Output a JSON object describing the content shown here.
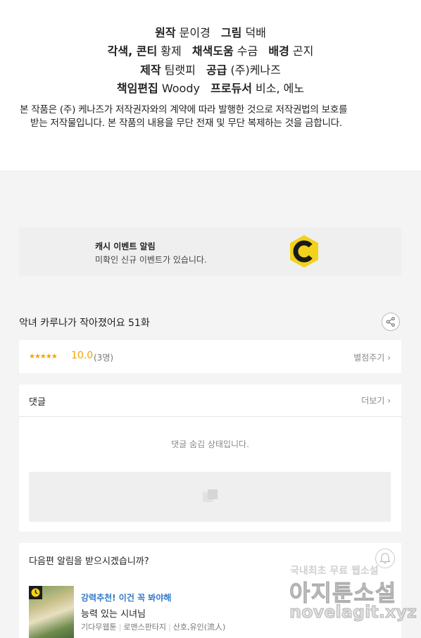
{
  "credits": {
    "line1": {
      "k1": "원작",
      "v1": "문이경",
      "k2": "그림",
      "v2": "덕배"
    },
    "line2": {
      "k1": "각색, 콘티",
      "v1": "황제",
      "k2": "채색도움",
      "v2": "수금",
      "k3": "배경",
      "v3": "곤지"
    },
    "line3": {
      "k1": "제작",
      "v1": "팀랫피",
      "k2": "공급",
      "v2": "(주)케나즈"
    },
    "line4": {
      "k1": "책임편집",
      "v1": "Woody",
      "k2": "프로듀서",
      "v2": "비소, 에노"
    },
    "notice_line1": "본 작품은 (주) 케나즈가 저작권자와의 계약에 따라 발행한 것으로 저작권법의 보호를",
    "notice_line2": "받는 저작물입니다. 본 작품의 내용을 무단 전재 및 무단 복제하는 것을 금합니다."
  },
  "banner": {
    "title": "캐시 이벤트 알림",
    "subtitle": "미확인 신규 이벤트가 있습니다.",
    "icon": "cash-coin-icon"
  },
  "episode": {
    "title": "악녀 카루나가 작아졌어요 51화"
  },
  "rating": {
    "stars": "★★★★★",
    "score": "10.0",
    "count": "(3명)",
    "rate_link": "별점주기"
  },
  "comments": {
    "title": "댓글",
    "more": "더보기",
    "hidden_msg": "댓글 숨김 상태입니다."
  },
  "next_alert": {
    "question": "다음편 알림을 받으시겠습니까?"
  },
  "recommend": {
    "label": "강력추천! 이건 꼭 봐야해",
    "title": "능력 있는 시녀님",
    "meta1": "기다무웹툰",
    "meta2": "로맨스판타지",
    "meta3": "산호,유인(流人)"
  },
  "watermark": {
    "line1": "국내최초 무료 웹소설",
    "line2": "아지툰소설",
    "line3": "novelagit.xyz"
  },
  "colors": {
    "accent_gold": "#f5a300",
    "link_blue": "#2f7bc9",
    "coin_yellow": "#f2d21b"
  }
}
